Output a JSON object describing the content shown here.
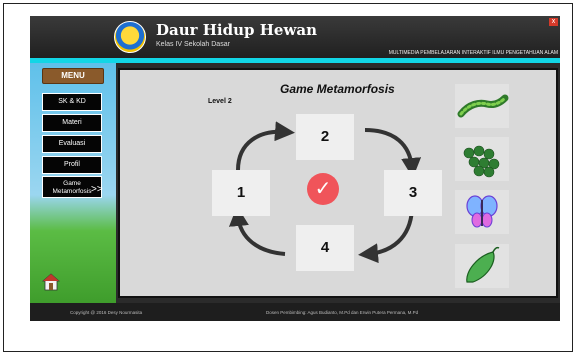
{
  "header": {
    "title": "Daur Hidup Hewan",
    "subtitle": "Kelas IV Sekolah Dasar",
    "tagline": "MULTIMEDIA PEMBELAJARAN INTERAKTIF ILMU PENGETAHUAN ALAM",
    "close_label": "x",
    "logo_icon": "school-emblem"
  },
  "sidebar": {
    "menu_label": "MENU",
    "items": [
      {
        "label": "SK & KD"
      },
      {
        "label": "Materi"
      },
      {
        "label": "Evaluasi"
      },
      {
        "label": "Profil"
      },
      {
        "label_line1": "Game",
        "label_line2": "Metamorfosis",
        "arrow": ">>"
      }
    ],
    "home_icon": "home-icon"
  },
  "game": {
    "title": "Game Metamorfosis",
    "level": "Level 2",
    "boxes": [
      "1",
      "2",
      "3",
      "4"
    ],
    "check_glyph": "✓",
    "tiles": [
      "caterpillar",
      "eggs",
      "butterfly",
      "pupa"
    ]
  },
  "colors": {
    "accent_cyan": "#12d6e6",
    "check_red": "#f0545a",
    "menu_brown": "#8a5a2b"
  },
  "footer": {
    "copyright": "Copyright @ 2016 Desy Nourmasita",
    "credit": "Dosen Pembimbing: Agus Budianto, M.Pd dan Erwin Putera Permana, M.Pd"
  }
}
